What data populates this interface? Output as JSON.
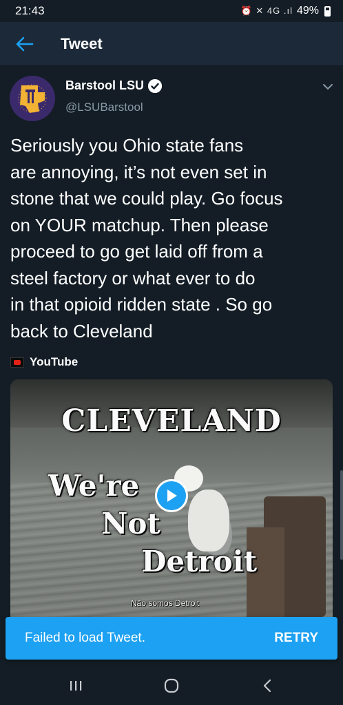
{
  "status_bar": {
    "time": "21:43",
    "icons": "⏰ ✕ 4G .ıl",
    "battery": "49%"
  },
  "app_bar": {
    "title": "Tweet",
    "back_icon": "arrow-left-icon"
  },
  "tweet": {
    "display_name": "Barstool LSU",
    "handle": "@LSUBarstool",
    "verified": true,
    "text_lines": [
      "Seriously you Ohio state fans",
      "are annoying, it’s not even set in",
      "stone that we could play. Go focus",
      "on YOUR matchup. Then please",
      "proceed to go get laid off from a",
      "steel factory or what ever to do",
      "in that opioid ridden state . So go",
      "back to Cleveland"
    ]
  },
  "media": {
    "source_label": "YouTube",
    "video_title": "CLEVELAND",
    "video_lines": [
      "We're",
      "Not",
      "Detroit"
    ],
    "subtitle": "Não somos Detroit"
  },
  "toast": {
    "message": "Failed to load Tweet.",
    "action": "RETRY"
  },
  "colors": {
    "background": "#141d26",
    "app_bar": "#1c2938",
    "accent": "#1da1f2",
    "secondary_text": "#8899a6"
  }
}
